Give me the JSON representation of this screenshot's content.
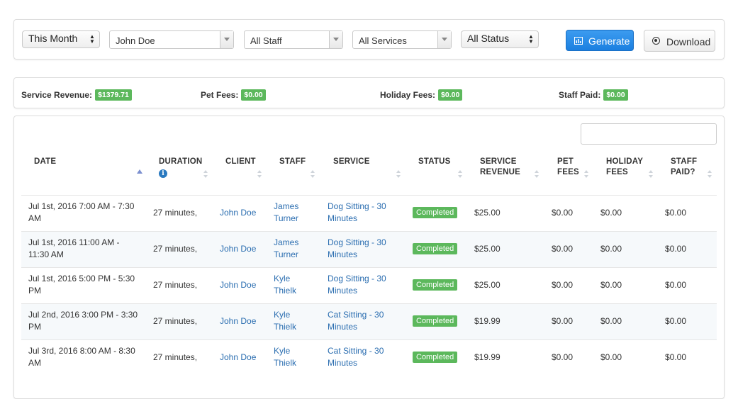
{
  "filters": {
    "period": "This Month",
    "client": "John Doe",
    "staff": "All Staff",
    "services": "All Services",
    "status": "All Status",
    "generate_label": "Generate",
    "download_label": "Download"
  },
  "totals": {
    "service_revenue_label": "Service Revenue:",
    "service_revenue_value": "$1379.71",
    "pet_fees_label": "Pet Fees:",
    "pet_fees_value": "$0.00",
    "holiday_fees_label": "Holiday Fees:",
    "holiday_fees_value": "$0.00",
    "staff_paid_label": "Staff Paid:",
    "staff_paid_value": "$0.00"
  },
  "search": {
    "value": ""
  },
  "table": {
    "columns": {
      "date": "DATE",
      "duration": "DURATION",
      "client": "CLIENT",
      "staff": "STAFF",
      "service": "SERVICE",
      "status": "STATUS",
      "service_revenue_1": "SERVICE",
      "service_revenue_2": "REVENUE",
      "pet_fees_1": "PET",
      "pet_fees_2": "FEES",
      "holiday_fees_1": "HOLIDAY",
      "holiday_fees_2": "FEES",
      "staff_paid_1": "STAFF",
      "staff_paid_2": "PAID?"
    },
    "rows": [
      {
        "date1": "Jul 1st, 2016 7:00 AM - 7:30",
        "date2": "AM",
        "duration": "27 minutes,",
        "client": "John Doe",
        "staff1": "James",
        "staff2": "Turner",
        "service1": "Dog Sitting - 30",
        "service2": "Minutes",
        "status": "Completed",
        "revenue": "$25.00",
        "pet_fees": "$0.00",
        "holiday_fees": "$0.00",
        "staff_paid": "$0.00"
      },
      {
        "date1": "Jul 1st, 2016 11:00 AM -",
        "date2": "11:30 AM",
        "duration": "27 minutes,",
        "client": "John Doe",
        "staff1": "James",
        "staff2": "Turner",
        "service1": "Dog Sitting - 30",
        "service2": "Minutes",
        "status": "Completed",
        "revenue": "$25.00",
        "pet_fees": "$0.00",
        "holiday_fees": "$0.00",
        "staff_paid": "$0.00"
      },
      {
        "date1": "Jul 1st, 2016 5:00 PM - 5:30",
        "date2": "PM",
        "duration": "27 minutes,",
        "client": "John Doe",
        "staff1": "Kyle",
        "staff2": "Thielk",
        "service1": "Dog Sitting - 30",
        "service2": "Minutes",
        "status": "Completed",
        "revenue": "$25.00",
        "pet_fees": "$0.00",
        "holiday_fees": "$0.00",
        "staff_paid": "$0.00"
      },
      {
        "date1": "Jul 2nd, 2016 3:00 PM - 3:30",
        "date2": "PM",
        "duration": "27 minutes,",
        "client": "John Doe",
        "staff1": "Kyle",
        "staff2": "Thielk",
        "service1": "Cat Sitting - 30",
        "service2": "Minutes",
        "status": "Completed",
        "revenue": "$19.99",
        "pet_fees": "$0.00",
        "holiday_fees": "$0.00",
        "staff_paid": "$0.00"
      },
      {
        "date1": "Jul 3rd, 2016 8:00 AM - 8:30",
        "date2": "AM",
        "duration": "27 minutes,",
        "client": "John Doe",
        "staff1": "Kyle",
        "staff2": "Thielk",
        "service1": "Cat Sitting - 30",
        "service2": "Minutes",
        "status": "Completed",
        "revenue": "$19.99",
        "pet_fees": "$0.00",
        "holiday_fees": "$0.00",
        "staff_paid": "$0.00"
      }
    ]
  },
  "colors": {
    "primary": "#1b7fe0",
    "success": "#5cb85c",
    "link": "#2a6db0"
  }
}
